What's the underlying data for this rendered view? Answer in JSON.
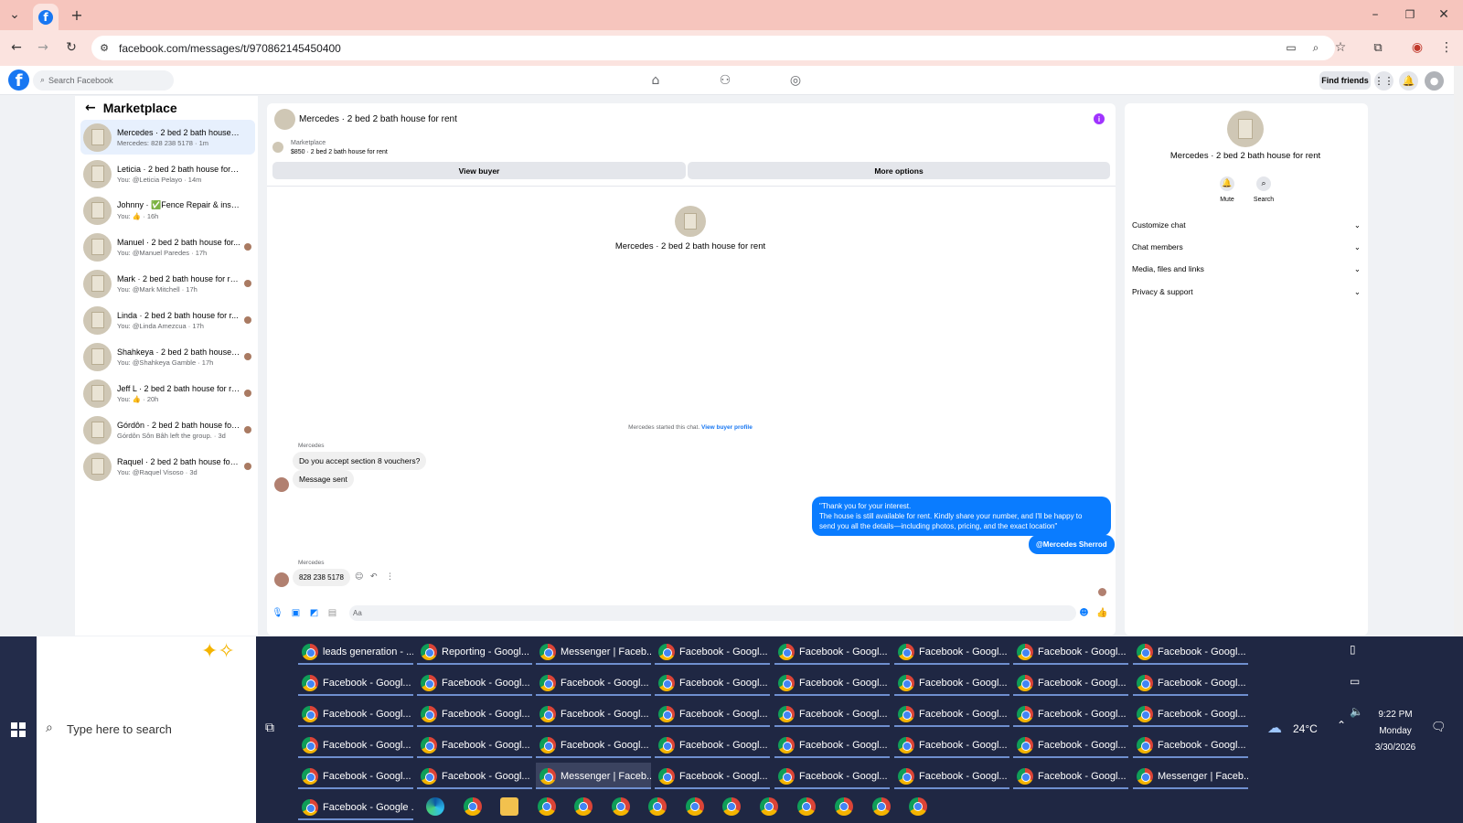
{
  "browser": {
    "url": "facebook.com/messages/t/970862145450400",
    "tab_icon": "facebook-icon"
  },
  "fb": {
    "search_placeholder": "Search Facebook",
    "find_friends": "Find friends"
  },
  "left": {
    "title": "Marketplace",
    "conversations": [
      {
        "name": "Mercedes · 2 bed 2 bath house for...",
        "sub": "Mercedes: 828 238 5178 · 1m",
        "active": true
      },
      {
        "name": "Leticia · 2 bed 2 bath house for rent",
        "sub": "You: @Leticia Pelayo · 14m"
      },
      {
        "name": "Johnny · ✅Fence Repair & installa...",
        "sub": "You: 👍 · 16h"
      },
      {
        "name": "Manuel · 2 bed 2 bath house for...",
        "sub": "You: @Manuel Paredes · 17h"
      },
      {
        "name": "Mark · 2 bed 2 bath house for re...",
        "sub": "You: @Mark Mitchell · 17h"
      },
      {
        "name": "Linda · 2 bed 2 bath house for r...",
        "sub": "You: @Linda Amezcua · 17h"
      },
      {
        "name": "Shahkeya · 2 bed 2 bath house f...",
        "sub": "You: @Shahkeya Gamble · 17h"
      },
      {
        "name": "Jeff L · 2 bed 2 bath house for re...",
        "sub": "You: 👍 · 20h"
      },
      {
        "name": "Górdôn · 2 bed 2 bath house for re...",
        "sub": "Górdôn Sôn Bâh left the group. · 3d"
      },
      {
        "name": "Raquel · 2 bed 2 bath house for ...",
        "sub": "You: @Raquel Visoso · 3d"
      }
    ]
  },
  "chat": {
    "title": "Mercedes · 2 bed 2 bath house for rent",
    "listing_label": "Marketplace",
    "listing_price": "$850 · 2 bed 2 bath house for rent",
    "view_buyer": "View buyer",
    "more_options": "More options",
    "center_name": "Mercedes · 2 bed 2 bath house for rent",
    "started_text": "Mercedes started this chat.",
    "started_link": "View buyer profile",
    "sender1": "Mercedes",
    "msg1": "Do you accept section 8 vouchers?",
    "msg2": "Message sent",
    "out1_line1": "\"Thank you for your interest.",
    "out1_line2": "The house is still available for rent. Kindly share your number, and I'll be happy to",
    "out1_line3": "send you all the details—including photos, pricing, and the exact location\"",
    "out2": "@Mercedes Sherrod",
    "sender2": "Mercedes",
    "msg3": "828 238 5178",
    "composer_value": "Aa"
  },
  "right": {
    "name": "Mercedes · 2 bed 2 bath house for rent",
    "mute": "Mute",
    "search": "Search",
    "sections": [
      "Customize chat",
      "Chat members",
      "Media, files and links",
      "Privacy & support"
    ]
  },
  "taskbar": {
    "search_placeholder": "Type here to search",
    "weather": "24°C",
    "time": "9:22 PM",
    "day": "Monday",
    "date": "3/30/2026",
    "rows": [
      [
        "leads generation - ...",
        "Reporting - Googl...",
        "Messenger | Faceb...",
        "Facebook - Googl...",
        "Facebook - Googl...",
        "Facebook - Googl...",
        "Facebook - Googl...",
        "Facebook - Googl..."
      ],
      [
        "Facebook - Googl...",
        "Facebook - Googl...",
        "Facebook - Googl...",
        "Facebook - Googl...",
        "Facebook - Googl...",
        "Facebook - Googl...",
        "Facebook - Googl...",
        "Facebook - Googl..."
      ],
      [
        "Facebook - Googl...",
        "Facebook - Googl...",
        "Facebook - Googl...",
        "Facebook - Googl...",
        "Facebook - Googl...",
        "Facebook - Googl...",
        "Facebook - Googl...",
        "Facebook - Googl..."
      ],
      [
        "Facebook - Googl...",
        "Facebook - Googl...",
        "Facebook - Googl...",
        "Facebook - Googl...",
        "Facebook - Googl...",
        "Facebook - Googl...",
        "Facebook - Googl...",
        "Facebook - Googl..."
      ],
      [
        "Facebook - Googl...",
        "Facebook - Googl...",
        "Messenger | Faceb...",
        "Facebook - Googl...",
        "Facebook - Googl...",
        "Facebook - Googl...",
        "Facebook - Googl...",
        "Messenger | Faceb..."
      ]
    ],
    "last_item": "Facebook - Google ...",
    "selected_row": 4,
    "selected_col": 2
  }
}
